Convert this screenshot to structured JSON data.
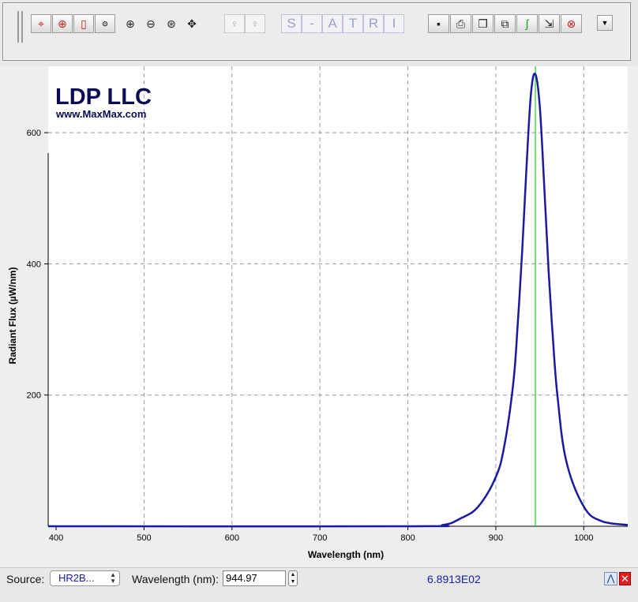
{
  "toolbar": {
    "selection_icons": [
      "crosshair-icon",
      "target-icon",
      "vertical-cursor-icon",
      "zoom-fit-icon"
    ],
    "zoom_icons": [
      "zoom-in-icon",
      "zoom-out-icon",
      "zoom-reset-icon",
      "pan-icon"
    ],
    "bulb_icons": [
      "bulb-off-icon",
      "bulb-on-icon"
    ],
    "mode_buttons": [
      {
        "label": "S",
        "name": "mode-s-button"
      },
      {
        "label": "-",
        "name": "mode-dash-button"
      },
      {
        "label": "A",
        "name": "mode-a-button"
      },
      {
        "label": "T",
        "name": "mode-t-button"
      },
      {
        "label": "R",
        "name": "mode-r-button"
      },
      {
        "label": "I",
        "name": "mode-i-button"
      }
    ],
    "action_icons": [
      "save-icon",
      "print-icon",
      "copy-icon",
      "copy-all-icon",
      "curve-icon",
      "export-icon",
      "delete-icon"
    ]
  },
  "chart": {
    "logo_title": "LDP LLC",
    "logo_url": "www.MaxMax.com",
    "xlabel": "Wavelength (nm)",
    "ylabel": "Radiant Flux (µW/nm)",
    "colors": {
      "curve": "#1a1aa0",
      "marker": "#22cc22",
      "grid": "#9a9a9a"
    }
  },
  "chart_data": {
    "type": "line",
    "xlabel": "Wavelength (nm)",
    "ylabel": "Radiant Flux (µW/nm)",
    "xlim": [
      391,
      1050
    ],
    "ylim": [
      0,
      700
    ],
    "x_ticks": [
      400,
      500,
      600,
      700,
      800,
      900,
      1000
    ],
    "y_ticks": [
      200,
      400,
      600
    ],
    "grid": true,
    "marker_x": 944.97,
    "series": [
      {
        "x": [
          391,
          800,
          840,
          860,
          880,
          900,
          910,
          920,
          925,
          930,
          935,
          940,
          944.97,
          950,
          955,
          960,
          965,
          970,
          980,
          1000,
          1020,
          1050
        ],
        "y": [
          0,
          0,
          2,
          12,
          30,
          75,
          125,
          220,
          310,
          420,
          550,
          660,
          689.13,
          640,
          520,
          390,
          285,
          200,
          100,
          30,
          8,
          2
        ]
      }
    ]
  },
  "status": {
    "source_label": "Source:",
    "source_value": "HR2B...",
    "wavelength_label": "Wavelength (nm):",
    "wavelength_value": "944.97",
    "readout": "6.8913E02"
  }
}
